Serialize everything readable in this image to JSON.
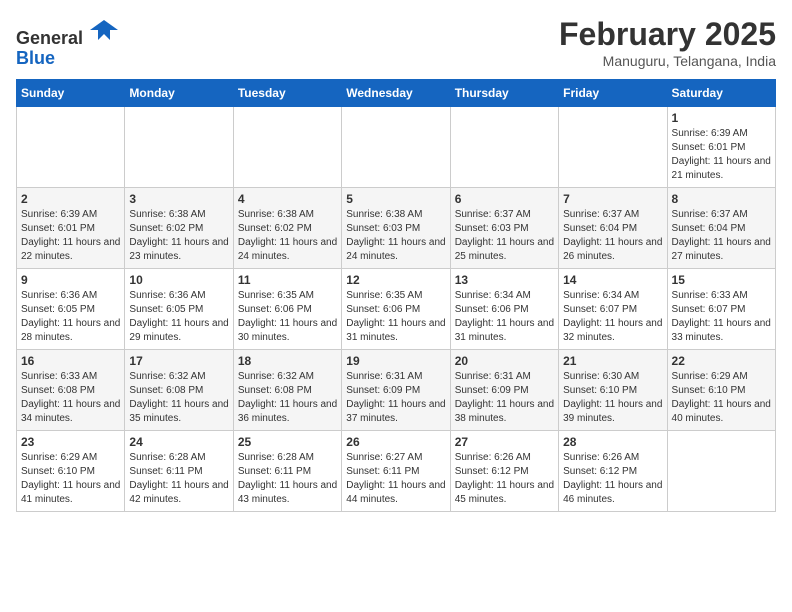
{
  "header": {
    "logo_general": "General",
    "logo_blue": "Blue",
    "month_title": "February 2025",
    "location": "Manuguru, Telangana, India"
  },
  "weekdays": [
    "Sunday",
    "Monday",
    "Tuesday",
    "Wednesday",
    "Thursday",
    "Friday",
    "Saturday"
  ],
  "weeks": [
    [
      {
        "day": "",
        "info": ""
      },
      {
        "day": "",
        "info": ""
      },
      {
        "day": "",
        "info": ""
      },
      {
        "day": "",
        "info": ""
      },
      {
        "day": "",
        "info": ""
      },
      {
        "day": "",
        "info": ""
      },
      {
        "day": "1",
        "info": "Sunrise: 6:39 AM\nSunset: 6:01 PM\nDaylight: 11 hours and 21 minutes."
      }
    ],
    [
      {
        "day": "2",
        "info": "Sunrise: 6:39 AM\nSunset: 6:01 PM\nDaylight: 11 hours and 22 minutes."
      },
      {
        "day": "3",
        "info": "Sunrise: 6:38 AM\nSunset: 6:02 PM\nDaylight: 11 hours and 23 minutes."
      },
      {
        "day": "4",
        "info": "Sunrise: 6:38 AM\nSunset: 6:02 PM\nDaylight: 11 hours and 24 minutes."
      },
      {
        "day": "5",
        "info": "Sunrise: 6:38 AM\nSunset: 6:03 PM\nDaylight: 11 hours and 24 minutes."
      },
      {
        "day": "6",
        "info": "Sunrise: 6:37 AM\nSunset: 6:03 PM\nDaylight: 11 hours and 25 minutes."
      },
      {
        "day": "7",
        "info": "Sunrise: 6:37 AM\nSunset: 6:04 PM\nDaylight: 11 hours and 26 minutes."
      },
      {
        "day": "8",
        "info": "Sunrise: 6:37 AM\nSunset: 6:04 PM\nDaylight: 11 hours and 27 minutes."
      }
    ],
    [
      {
        "day": "9",
        "info": "Sunrise: 6:36 AM\nSunset: 6:05 PM\nDaylight: 11 hours and 28 minutes."
      },
      {
        "day": "10",
        "info": "Sunrise: 6:36 AM\nSunset: 6:05 PM\nDaylight: 11 hours and 29 minutes."
      },
      {
        "day": "11",
        "info": "Sunrise: 6:35 AM\nSunset: 6:06 PM\nDaylight: 11 hours and 30 minutes."
      },
      {
        "day": "12",
        "info": "Sunrise: 6:35 AM\nSunset: 6:06 PM\nDaylight: 11 hours and 31 minutes."
      },
      {
        "day": "13",
        "info": "Sunrise: 6:34 AM\nSunset: 6:06 PM\nDaylight: 11 hours and 31 minutes."
      },
      {
        "day": "14",
        "info": "Sunrise: 6:34 AM\nSunset: 6:07 PM\nDaylight: 11 hours and 32 minutes."
      },
      {
        "day": "15",
        "info": "Sunrise: 6:33 AM\nSunset: 6:07 PM\nDaylight: 11 hours and 33 minutes."
      }
    ],
    [
      {
        "day": "16",
        "info": "Sunrise: 6:33 AM\nSunset: 6:08 PM\nDaylight: 11 hours and 34 minutes."
      },
      {
        "day": "17",
        "info": "Sunrise: 6:32 AM\nSunset: 6:08 PM\nDaylight: 11 hours and 35 minutes."
      },
      {
        "day": "18",
        "info": "Sunrise: 6:32 AM\nSunset: 6:08 PM\nDaylight: 11 hours and 36 minutes."
      },
      {
        "day": "19",
        "info": "Sunrise: 6:31 AM\nSunset: 6:09 PM\nDaylight: 11 hours and 37 minutes."
      },
      {
        "day": "20",
        "info": "Sunrise: 6:31 AM\nSunset: 6:09 PM\nDaylight: 11 hours and 38 minutes."
      },
      {
        "day": "21",
        "info": "Sunrise: 6:30 AM\nSunset: 6:10 PM\nDaylight: 11 hours and 39 minutes."
      },
      {
        "day": "22",
        "info": "Sunrise: 6:29 AM\nSunset: 6:10 PM\nDaylight: 11 hours and 40 minutes."
      }
    ],
    [
      {
        "day": "23",
        "info": "Sunrise: 6:29 AM\nSunset: 6:10 PM\nDaylight: 11 hours and 41 minutes."
      },
      {
        "day": "24",
        "info": "Sunrise: 6:28 AM\nSunset: 6:11 PM\nDaylight: 11 hours and 42 minutes."
      },
      {
        "day": "25",
        "info": "Sunrise: 6:28 AM\nSunset: 6:11 PM\nDaylight: 11 hours and 43 minutes."
      },
      {
        "day": "26",
        "info": "Sunrise: 6:27 AM\nSunset: 6:11 PM\nDaylight: 11 hours and 44 minutes."
      },
      {
        "day": "27",
        "info": "Sunrise: 6:26 AM\nSunset: 6:12 PM\nDaylight: 11 hours and 45 minutes."
      },
      {
        "day": "28",
        "info": "Sunrise: 6:26 AM\nSunset: 6:12 PM\nDaylight: 11 hours and 46 minutes."
      },
      {
        "day": "",
        "info": ""
      }
    ]
  ]
}
